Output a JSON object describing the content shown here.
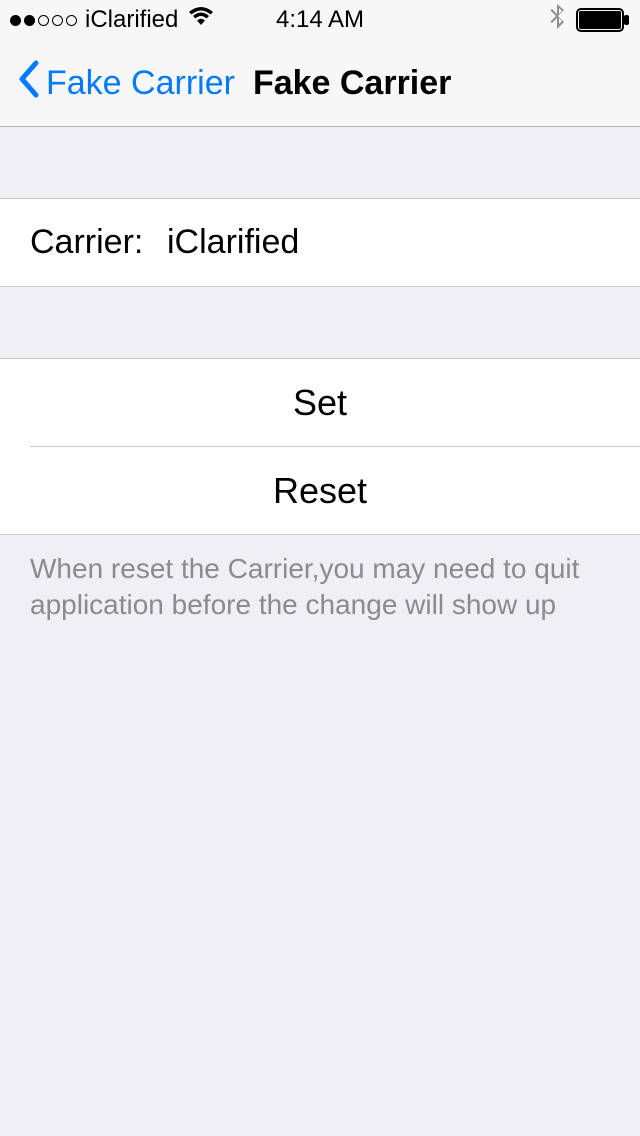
{
  "statusBar": {
    "carrier": "iClarified",
    "time": "4:14 AM"
  },
  "nav": {
    "backLabel": "Fake Carrier",
    "title": "Fake Carrier"
  },
  "form": {
    "carrierLabel": "Carrier:",
    "carrierValue": "iClarified"
  },
  "buttons": {
    "set": "Set",
    "reset": "Reset"
  },
  "footer": {
    "note": "When reset the Carrier,you may need to quit application before the change will show up"
  }
}
